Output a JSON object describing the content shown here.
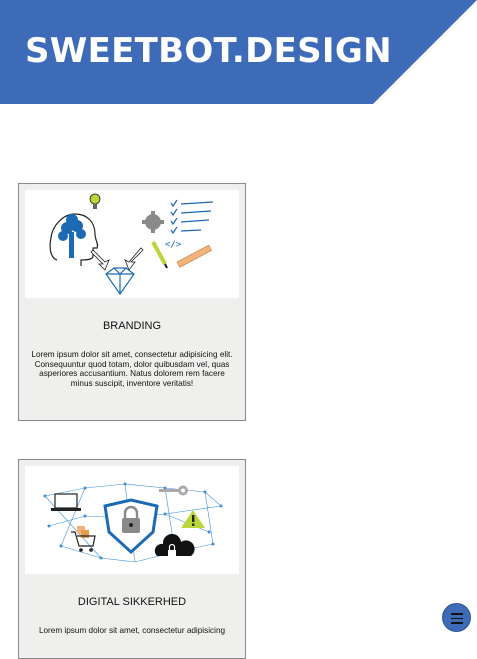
{
  "header": {
    "title": "SWEETBOT.DESIGN",
    "color": "#3d6bb8"
  },
  "cards": [
    {
      "title": "BRANDING",
      "text": "Lorem ipsum dolor sit amet, consectetur adipisicing elit. Consequuntur quod totam, dolor quibusdam vel, quas asperiores accusantium. Natus dolorem rem facere minus suscipit, inventore veritatis!",
      "icon": "branding-illustration"
    },
    {
      "title": "DIGITAL SIKKERHED",
      "text": "Lorem ipsum dolor sit amet, consectetur adipisicing",
      "icon": "security-network-illustration"
    }
  ],
  "menu": {
    "icon": "hamburger-menu-icon"
  }
}
